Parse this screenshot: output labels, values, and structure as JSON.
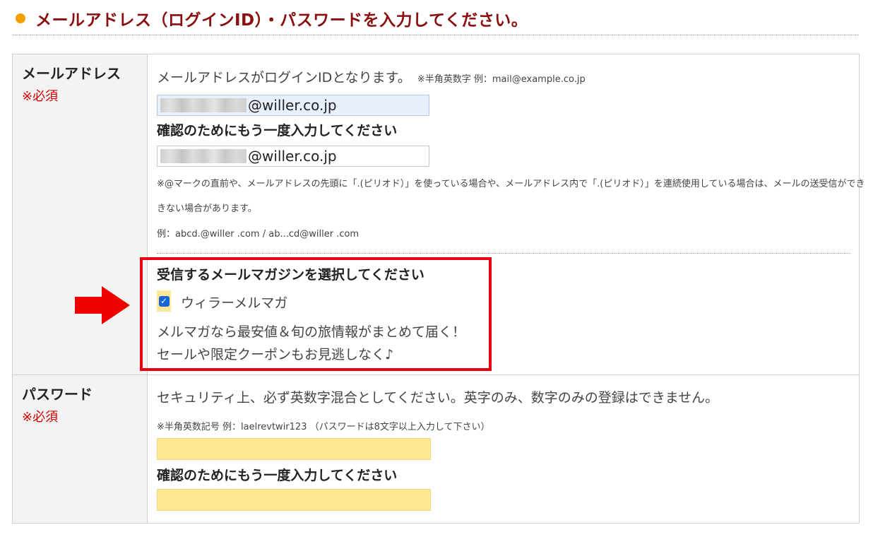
{
  "section": {
    "title": "メールアドレス（ログインID）・パスワードを入力してください。"
  },
  "email": {
    "label": "メールアドレス",
    "required": "※必須",
    "intro": "メールアドレスがログインIDとなります。",
    "hint": "※半角英数字 例：mail@example.co.jp",
    "value_suffix": "@willer.co.jp",
    "confirm_label": "確認のためにもう一度入力してください",
    "confirm_value_suffix": "@willer.co.jp",
    "note_line1": "※@マークの直前や、メールアドレスの先頭に「.(ピリオド）」を使っている場合や、メールアドレス内で「.(ピリオド）」を連続使用している場合は、メールの送受信ができ",
    "note_line2": "きない場合があります。",
    "example": "例：abcd.@willer .com / ab...cd@willer .com"
  },
  "newsletter": {
    "heading": "受信するメールマガジンを選択してください",
    "option_label": "ウィラーメルマガ",
    "checked": true,
    "checkmark": "✓",
    "promo_line1": "メルマガなら最安値＆旬の旅情報がまとめて届く！",
    "promo_line2": "セールや限定クーポンもお見逃しなく♪"
  },
  "password": {
    "label": "パスワード",
    "required": "※必須",
    "intro": "セキュリティ上、必ず英数字混合としてください。英字のみ、数字のみの登録はできません。",
    "hint": "※半角英数記号 例：laelrevtwir123 （パスワードは8文字以上入力して下さい）",
    "value": "",
    "confirm_label": "確認のためにもう一度入力してください",
    "confirm_value": ""
  },
  "colors": {
    "title": "#8a0e0e",
    "bullet": "#f5a000",
    "required": "#d40000",
    "highlight_box": "#e60012",
    "arrow": "#ee0000",
    "input_yellow": "#fee890",
    "input_focus_blue": "#e8f0fe",
    "checkbox": "#1565d8"
  },
  "icons": {
    "bullet": "orange-bullet-icon",
    "arrow": "right-arrow-icon",
    "checkbox": "checkbox-checked-icon"
  }
}
